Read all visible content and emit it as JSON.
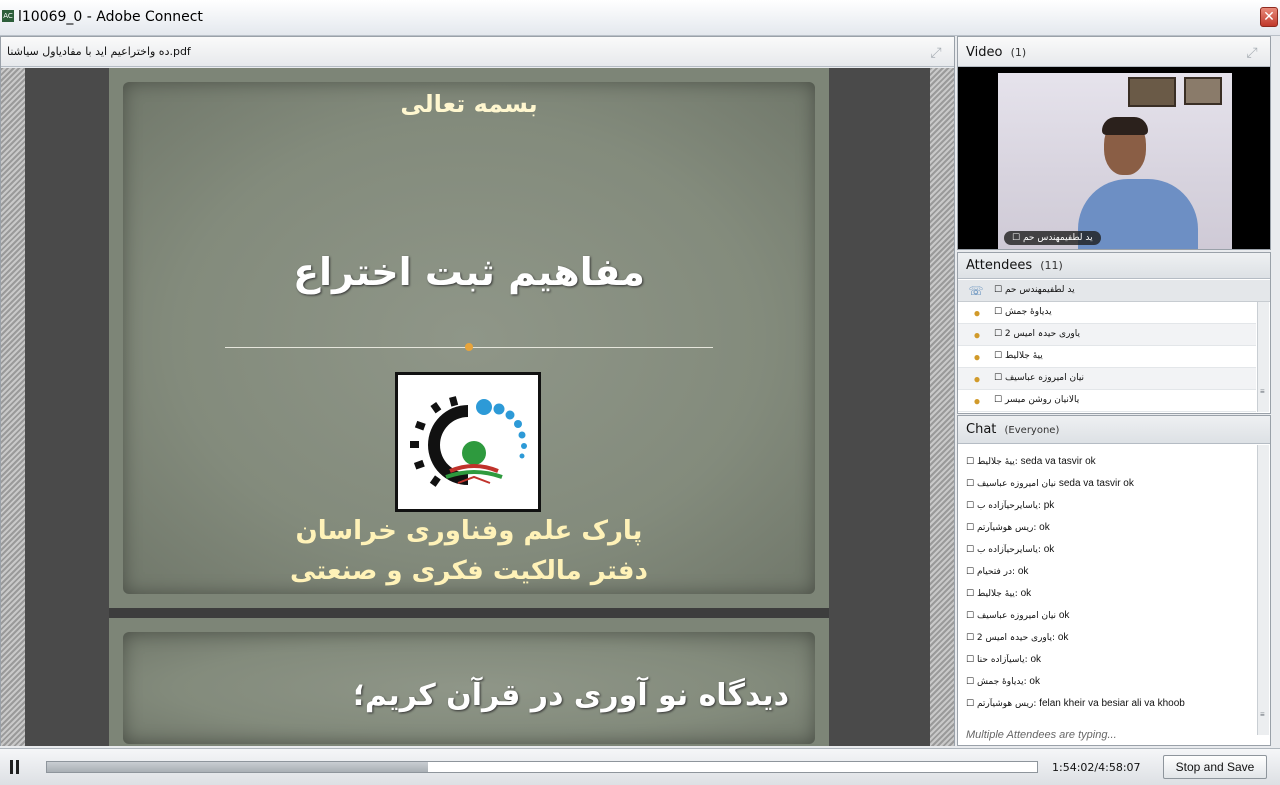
{
  "window": {
    "title": "l10069_0 - Adobe Connect",
    "icon": "adobe-connect-icon",
    "icon_text": "AC",
    "close_label": "✕"
  },
  "share_pod": {
    "title": "ده واختراعیم اید با مفادیاول سیاشنا.pdf",
    "maximize_icon": "maximize-icon",
    "slides": [
      {
        "bismillah": "بسمه تعالی",
        "heading": "مفاهیم ثبت اختراع",
        "org_line1": "پارک علم وفناوری خراسان",
        "org_line2": "دفتر مالکیت فکری و صنعتی"
      },
      {
        "heading": "دیدگاه نو آوری در قرآن کریم؛"
      }
    ],
    "colors": {
      "accent": "#e7a43b",
      "title_text": "#fff2b8"
    }
  },
  "video_pod": {
    "title": "Video",
    "count": "(1)",
    "presenter_label": "☐ ید لطفیمهندس حم"
  },
  "attendees_pod": {
    "title": "Attendees",
    "count": "(11)",
    "host": {
      "name": "☐ ید لطفیمهندس حم",
      "icon": "phone-icon"
    },
    "items": [
      {
        "name": "☐ یدیاوهٔ جمش",
        "icon": "user-icon"
      },
      {
        "name": "☐ 2 یاوری حیدہ امیس",
        "icon": "user-group-icon"
      },
      {
        "name": "☐ ییهٔ جلالیط",
        "icon": "user-icon"
      },
      {
        "name": "☐ نیان امیروزه عباسیف",
        "icon": "user-icon"
      },
      {
        "name": "☐ یالانیان روشن میسر",
        "icon": "user-group-icon"
      }
    ]
  },
  "chat_pod": {
    "title": "Chat",
    "subtitle": "(Everyone)",
    "messages": [
      {
        "name": "☐ ییهٔ جلالیط:",
        "text": " seda va tasvir ok"
      },
      {
        "name": "☐ نیان امیروزه عباسیف",
        "text": " seda va tasvir  ok"
      },
      {
        "name": "☐ یاسایرحیآزاده ب:",
        "text": " pk"
      },
      {
        "name": "☐ ریس هوشیآرتم:",
        "text": " ok"
      },
      {
        "name": "☐ یاسایرحیآزاده ب:",
        "text": " ok"
      },
      {
        "name": "☐ در فتحیام:",
        "text": " ok"
      },
      {
        "name": "☐ ییهٔ جلالیط:",
        "text": " ok"
      },
      {
        "name": "☐ نیان امیروزه عباسیف",
        "text": " ok"
      },
      {
        "name": "☐ 2 یاوری حیدہ امیس:",
        "text": " ok"
      },
      {
        "name": "☐ یاسیآزاده حنا:",
        "text": " ok"
      },
      {
        "name": "☐ یدیاوهٔ جمش:",
        "text": " ok"
      },
      {
        "name": "☐ ریس هوشیآرتم:",
        "text": " felan kheir va besiar ali va khoob"
      }
    ],
    "typing_indicator": "Multiple Attendees are typing..."
  },
  "playback": {
    "progress_fraction": 0.385,
    "time": "1:54:02/4:58:07",
    "stop_button_label": "Stop and Save"
  }
}
